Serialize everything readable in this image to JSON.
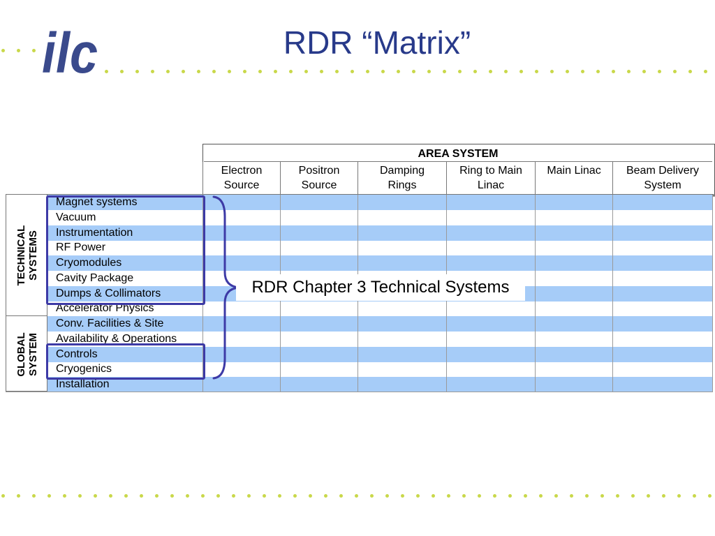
{
  "header": {
    "logo_text": "ilc",
    "title": "RDR “Matrix”"
  },
  "colors": {
    "title": "#283a8a",
    "logo": "#3a4a8c",
    "dots": "#c9d84a",
    "band": "#a6ccf8",
    "highlight": "#3d3aa6"
  },
  "matrix": {
    "area_header": "AREA SYSTEM",
    "columns": [
      {
        "line1": "Electron",
        "line2": "Source"
      },
      {
        "line1": "Positron",
        "line2": "Source"
      },
      {
        "line1": "Damping",
        "line2": "Rings"
      },
      {
        "line1": "Ring to Main",
        "line2": "Linac"
      },
      {
        "line1": "Main Linac",
        "line2": ""
      },
      {
        "line1": "Beam Delivery",
        "line2": "System"
      }
    ],
    "group_technical": {
      "line1": "TECHNICAL",
      "line2": "SYSTEMS"
    },
    "group_global": {
      "line1": "GLOBAL",
      "line2": "SYSTEM"
    },
    "rows": [
      "Magnet systems",
      "Vacuum",
      "Instrumentation",
      "RF Power",
      "Cryomodules",
      "Cavity Package",
      "Dumps & Collimators",
      "Accelerator Physics",
      "Conv. Facilities & Site",
      "Availability & Operations",
      "Controls",
      "Cryogenics",
      "Installation"
    ],
    "callout": "RDR Chapter 3 Technical Systems"
  }
}
